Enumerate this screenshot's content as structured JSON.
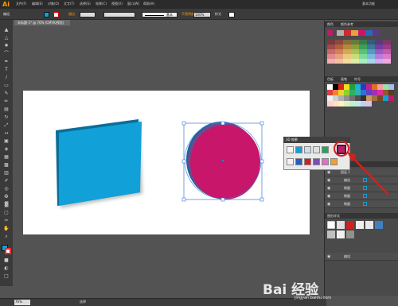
{
  "app": {
    "logo": "Ai"
  },
  "menu": [
    "文件(F)",
    "编辑(E)",
    "对象(O)",
    "文字(T)",
    "选择(S)",
    "效果(C)",
    "视图(V)",
    "窗口(W)",
    "帮助(H)"
  ],
  "workspace": "基本功能",
  "control": {
    "selection_label": "编组",
    "stroke_label": "描边",
    "style_label": "基本",
    "opacity_label": "不透明度",
    "opacity_value": "100%",
    "style2_label": "样式"
  },
  "document_tab": "未标题-1* @ 76% (CMYK/预览)",
  "panels": {
    "swatches_tab": "颜色",
    "guide_tab": "颜色参考",
    "swatch_tab2": "色板",
    "brush_tab": "画笔",
    "symbol_tab": "符号",
    "layers_tab": "图层",
    "artboards_tab": "画板",
    "graphic_styles_tab": "图形样式"
  },
  "layers": {
    "layer_name": "图层 1",
    "items": [
      "编组",
      "椭圆",
      "椭圆",
      "椭圆"
    ],
    "sublayer": "编组"
  },
  "popup_title": "3D 效果",
  "status": {
    "zoom": "76%",
    "tool": "选择"
  },
  "watermark": {
    "text": "Bai 经验",
    "url": "jingyan.baidu.com"
  },
  "colors": {
    "accent_orange": "#ff9a00",
    "cyan_shape": "#11a0d8",
    "magenta_shape": "#c8166a",
    "selection_blue": "#3a7bd5",
    "arrow_red": "#d41f1f"
  }
}
